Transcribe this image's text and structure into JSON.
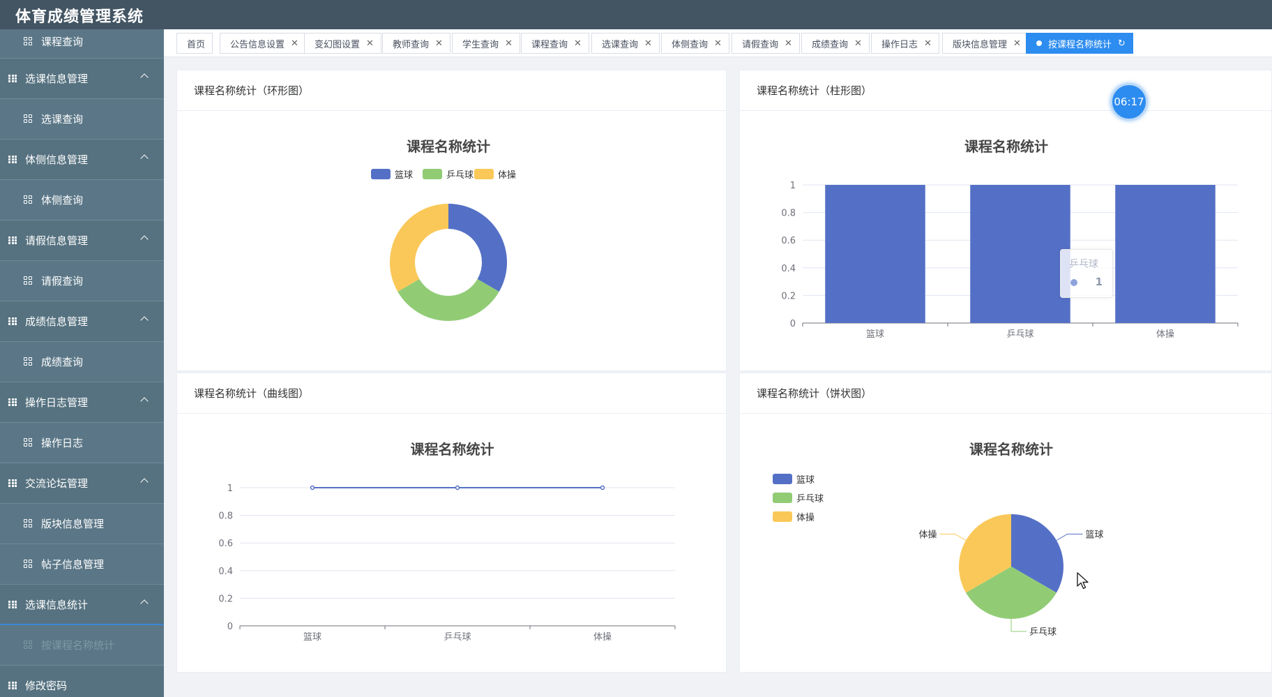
{
  "app": {
    "title": "体育成绩管理系统"
  },
  "sidebar": {
    "items": [
      {
        "type": "child",
        "label": "课程查询"
      },
      {
        "type": "parent",
        "label": "选课信息管理"
      },
      {
        "type": "child",
        "label": "选课查询"
      },
      {
        "type": "parent",
        "label": "体侧信息管理"
      },
      {
        "type": "child",
        "label": "体侧查询"
      },
      {
        "type": "parent",
        "label": "请假信息管理"
      },
      {
        "type": "child",
        "label": "请假查询"
      },
      {
        "type": "parent",
        "label": "成绩信息管理"
      },
      {
        "type": "child",
        "label": "成绩查询"
      },
      {
        "type": "parent",
        "label": "操作日志管理"
      },
      {
        "type": "child",
        "label": "操作日志"
      },
      {
        "type": "parent",
        "label": "交流论坛管理"
      },
      {
        "type": "child",
        "label": "版块信息管理"
      },
      {
        "type": "child",
        "label": "帖子信息管理"
      },
      {
        "type": "parent",
        "label": "选课信息统计"
      },
      {
        "type": "child",
        "label": "按课程名称统计",
        "active": true
      },
      {
        "type": "parent",
        "label": "修改密码"
      }
    ]
  },
  "tabs": [
    {
      "label": "首页",
      "closable": false
    },
    {
      "label": "公告信息设置",
      "closable": true
    },
    {
      "label": "变幻图设置",
      "closable": true
    },
    {
      "label": "教师查询",
      "closable": true
    },
    {
      "label": "学生查询",
      "closable": true
    },
    {
      "label": "课程查询",
      "closable": true
    },
    {
      "label": "选课查询",
      "closable": true
    },
    {
      "label": "体侧查询",
      "closable": true
    },
    {
      "label": "请假查询",
      "closable": true
    },
    {
      "label": "成绩查询",
      "closable": true
    },
    {
      "label": "操作日志",
      "closable": true
    },
    {
      "label": "版块信息管理",
      "closable": true
    },
    {
      "label": "按课程名称统计",
      "closable": false,
      "active": true
    }
  ],
  "panels": {
    "donut": {
      "header": "课程名称统计（环形图）"
    },
    "bar": {
      "header": "课程名称统计（柱形图）"
    },
    "line": {
      "header": "课程名称统计（曲线图）"
    },
    "pie": {
      "header": "课程名称统计（饼状图）"
    }
  },
  "timer": {
    "text": "06:17"
  },
  "tooltip": {
    "title": "乒乓球",
    "value": "1"
  },
  "colors": {
    "blue": "#5470c6",
    "green": "#91cc75",
    "yellow": "#fac858",
    "accent": "#2d8cf0",
    "sidebar": "#5a7685",
    "header": "#435563"
  },
  "chart_data": [
    {
      "type": "pie",
      "variant": "donut",
      "title": "课程名称统计",
      "legend": [
        "篮球",
        "乒乓球",
        "体操"
      ],
      "legend_position": "top",
      "categories": [
        "篮球",
        "乒乓球",
        "体操"
      ],
      "values": [
        1,
        1,
        1
      ]
    },
    {
      "type": "bar",
      "title": "课程名称统计",
      "categories": [
        "篮球",
        "乒乓球",
        "体操"
      ],
      "values": [
        1,
        1,
        1
      ],
      "ylim": [
        0,
        1
      ],
      "yticks": [
        "0",
        "0.2",
        "0.4",
        "0.6",
        "0.8",
        "1"
      ],
      "grid": true
    },
    {
      "type": "line",
      "title": "课程名称统计",
      "categories": [
        "篮球",
        "乒乓球",
        "体操"
      ],
      "values": [
        1,
        1,
        1
      ],
      "ylim": [
        0,
        1
      ],
      "yticks": [
        "0",
        "0.2",
        "0.4",
        "0.6",
        "0.8",
        "1"
      ],
      "grid": true
    },
    {
      "type": "pie",
      "title": "课程名称统计",
      "legend": [
        "篮球",
        "乒乓球",
        "体操"
      ],
      "legend_position": "left",
      "categories": [
        "篮球",
        "乒乓球",
        "体操"
      ],
      "values": [
        1,
        1,
        1
      ],
      "labels": [
        "篮球",
        "乒乓球",
        "体操"
      ]
    }
  ]
}
